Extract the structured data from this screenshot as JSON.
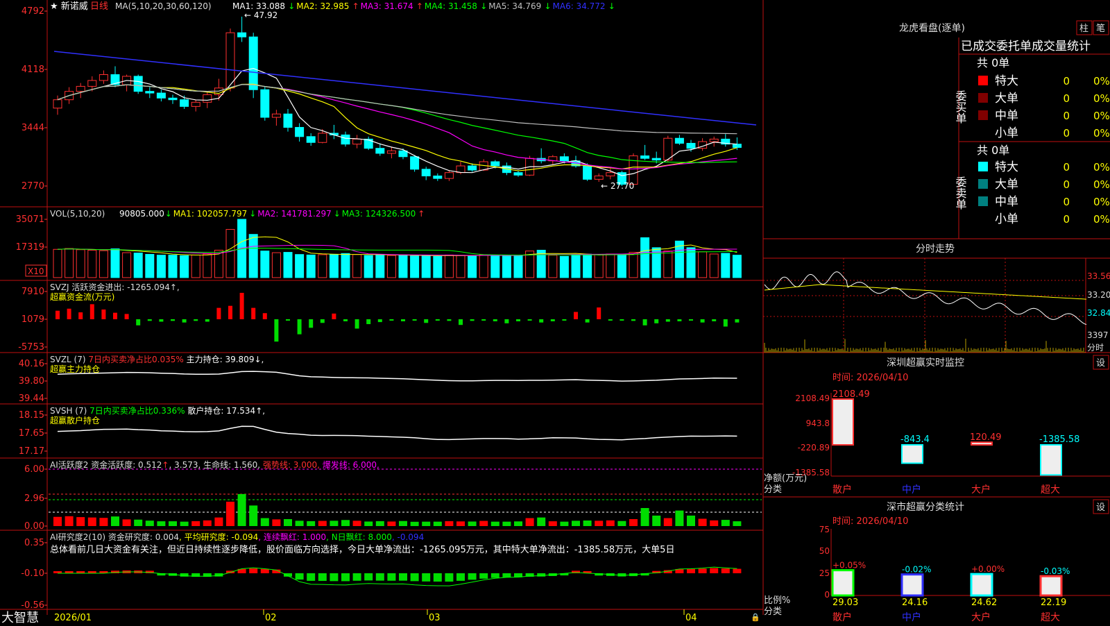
{
  "app": {
    "name": "大智慧"
  },
  "stock": {
    "name": "新诺威",
    "period": "日线"
  },
  "panels": {
    "price": {
      "ma_header": "MA(5,10,20,30,60,120)",
      "ma_items": [
        {
          "text": "MA1: 33.088",
          "arrow": "↓",
          "color": "#ffffff"
        },
        {
          "text": "MA2: 32.985",
          "arrow": "↑",
          "color": "#ffff00"
        },
        {
          "text": "MA3: 31.674",
          "arrow": "↑",
          "color": "#ff00ff"
        },
        {
          "text": "MA4: 31.458",
          "arrow": "↓",
          "color": "#00ff00"
        },
        {
          "text": "MA5: 34.769",
          "arrow": "↓",
          "color": "#c0c0c0"
        },
        {
          "text": "MA6: 34.772",
          "arrow": "↓",
          "color": "#3030ff"
        }
      ],
      "yticks": [
        "4792",
        "4118",
        "3444",
        "2770"
      ],
      "high_label": "47.92",
      "low_label": "27.70"
    },
    "volume": {
      "header": "VOL(5,10,20)",
      "items": [
        {
          "text": "90805.000",
          "arrow": "↓",
          "color": "#ffffff"
        },
        {
          "text": "MA1: 102057.797",
          "arrow": "↓",
          "color": "#ffff00"
        },
        {
          "text": "MA2: 141781.297",
          "arrow": "↓",
          "color": "#ff00ff"
        },
        {
          "text": "MA3: 124326.500",
          "arrow": "↑",
          "color": "#00ff00"
        }
      ],
      "yticks": [
        "35071",
        "17319"
      ],
      "unit": "X10"
    },
    "svzj": {
      "line1": "SVZJ  活跃资金进出: -1265.094↑,",
      "line2": "超赢资金流(万元)",
      "yticks": [
        "7910",
        "1079",
        "-5753"
      ]
    },
    "svzl": {
      "header": "SVZL (7)",
      "item1": "7日内买卖净占比0.035%",
      "item2": "主力持仓: 39.809↓,",
      "line2": "超赢主力持仓",
      "yticks": [
        "40.16",
        "39.80",
        "39.44"
      ]
    },
    "svsh": {
      "header": "SVSH (7)",
      "item1": "7日内买卖净占比0.336%",
      "item2": "散户持仓: 17.534↑,",
      "line2": "超赢散户持仓",
      "yticks": [
        "18.15",
        "17.65",
        "17.17"
      ]
    },
    "ai_active": {
      "part1": "AI活跃度2 资金活跃度: 0.512",
      "part2": ", 3.573, 生命线: 1.560,",
      "part3": "强势线: 3.000,",
      "part4": "爆发线: 6.000,",
      "yticks": [
        "6.00",
        "2.96",
        "0.00"
      ]
    },
    "ai_research": {
      "part1": "AI研究度2(10) 资金研究度: 0.004",
      "part2": ", 平均研究度: -0.094",
      "part3": ", 连续飘红: 1.000",
      "part4": ", N日飘红: 8.000",
      "part5": ", -0.094",
      "summary": "总体看前几日大资金有关注，但近日持续性逐步降低，股价面临方向选择，今日大单净流出：-1265.095万元，其中特大单净流出：-1385.58万元，大单5日",
      "yticks": [
        "0.35",
        "-0.10",
        "-0.56"
      ]
    }
  },
  "xaxis": {
    "labels": [
      "2026/01",
      "02",
      "03",
      "04"
    ]
  },
  "right": {
    "lhb": {
      "title": "龙虎看盘(逐单)",
      "btn1": "柱",
      "btn2": "笔",
      "subtitle": "已成交委托单成交量统计",
      "buy_label": "委买单",
      "sell_label": "委卖单",
      "buy_total": "共 0单",
      "sell_total": "共 0单",
      "buy_rows": [
        {
          "label": "特大",
          "num": "0",
          "pct": "0%",
          "color": "#ff0000"
        },
        {
          "label": "大单",
          "num": "0",
          "pct": "0%",
          "color": "#800000"
        },
        {
          "label": "中单",
          "num": "0",
          "pct": "0%",
          "color": "#800000"
        },
        {
          "label": "小单",
          "num": "0",
          "pct": "0%",
          "color": ""
        }
      ],
      "sell_rows": [
        {
          "label": "特大",
          "num": "0",
          "pct": "0%",
          "color": "#00ffff"
        },
        {
          "label": "大单",
          "num": "0",
          "pct": "0%",
          "color": "#008080"
        },
        {
          "label": "中单",
          "num": "0",
          "pct": "0%",
          "color": "#008080"
        },
        {
          "label": "小单",
          "num": "0",
          "pct": "0%",
          "color": ""
        }
      ]
    },
    "intraday": {
      "title": "分时走势",
      "yticks": [
        "33.56",
        "33.20",
        "32.84"
      ],
      "vol_tick": "3397",
      "vol_label": "分时"
    },
    "monitor": {
      "title": "深圳超赢实时监控",
      "set": "设",
      "time": "时间: 2026/04/10",
      "yticks": [
        "2108.49",
        "943.8",
        "-220.89",
        "-1385.58"
      ],
      "ylabel": "净额(万元)",
      "xlabel": "分类",
      "categories": [
        "散户",
        "中户",
        "大户",
        "超大"
      ],
      "values": [
        2108.49,
        -843.4,
        120.49,
        -1385.58
      ],
      "value_labels": [
        "2108.49",
        "-843.4",
        "120.49",
        "-1385.58"
      ]
    },
    "classify": {
      "title": "深市超赢分类统计",
      "set": "设",
      "time": "时间: 2026/04/10",
      "yticks": [
        "75",
        "50",
        "25",
        "0"
      ],
      "ylabel": "比例%",
      "xlabel": "分类",
      "categories": [
        "散户",
        "中户",
        "大户",
        "超大"
      ],
      "values": [
        29.03,
        24.16,
        24.62,
        22.19
      ],
      "changes": [
        "+0.05%",
        "-0.02%",
        "+0.00%",
        "-0.03%"
      ]
    }
  },
  "chart_data": [
    {
      "type": "candlestick",
      "title": "新诺威 日线",
      "x": [
        "2026/01",
        "02",
        "03",
        "04"
      ],
      "ylim": [
        27.7,
        47.92
      ],
      "high": 47.92,
      "low": 27.7,
      "ohlc": [
        [
          37.0,
          38.5,
          36.2,
          38.0
        ],
        [
          38.0,
          39.5,
          37.5,
          39.0
        ],
        [
          39.0,
          40.0,
          38.2,
          39.6
        ],
        [
          39.6,
          40.8,
          39.0,
          40.3
        ],
        [
          40.3,
          41.5,
          39.9,
          41.0
        ],
        [
          41.0,
          42.0,
          39.5,
          39.8
        ],
        [
          39.8,
          41.0,
          39.0,
          40.8
        ],
        [
          40.8,
          41.0,
          38.7,
          39.0
        ],
        [
          39.0,
          39.5,
          38.2,
          38.8
        ],
        [
          38.8,
          39.2,
          37.8,
          38.2
        ],
        [
          38.2,
          38.6,
          37.5,
          38.0
        ],
        [
          38.0,
          38.5,
          36.9,
          37.2
        ],
        [
          37.2,
          38.0,
          36.6,
          37.7
        ],
        [
          37.7,
          39.0,
          37.0,
          38.6
        ],
        [
          38.6,
          40.5,
          37.9,
          39.4
        ],
        [
          39.4,
          46.5,
          39.0,
          46.0
        ],
        [
          46.0,
          47.92,
          44.9,
          45.5
        ],
        [
          45.5,
          46.0,
          38.2,
          39.2
        ],
        [
          39.2,
          39.6,
          35.5,
          35.9
        ],
        [
          35.9,
          36.8,
          34.9,
          36.3
        ],
        [
          36.3,
          36.9,
          34.2,
          34.7
        ],
        [
          34.7,
          35.2,
          33.0,
          33.6
        ],
        [
          33.6,
          34.0,
          32.5,
          32.9
        ],
        [
          32.9,
          34.5,
          32.8,
          34.0
        ],
        [
          34.0,
          35.0,
          33.3,
          33.8
        ],
        [
          33.8,
          34.2,
          32.4,
          32.7
        ],
        [
          32.7,
          33.8,
          32.2,
          33.3
        ],
        [
          33.3,
          33.6,
          32.0,
          32.2
        ],
        [
          32.2,
          32.8,
          31.3,
          31.6
        ],
        [
          31.6,
          32.4,
          31.0,
          31.9
        ],
        [
          31.9,
          32.2,
          30.9,
          31.2
        ],
        [
          31.2,
          31.4,
          29.4,
          29.7
        ],
        [
          29.7,
          30.0,
          28.4,
          28.9
        ],
        [
          28.9,
          29.2,
          28.3,
          28.6
        ],
        [
          28.6,
          29.6,
          28.3,
          29.3
        ],
        [
          29.3,
          30.6,
          29.1,
          30.1
        ],
        [
          30.1,
          30.4,
          29.4,
          29.6
        ],
        [
          29.6,
          30.9,
          29.5,
          30.6
        ],
        [
          30.6,
          30.8,
          29.8,
          30.1
        ],
        [
          30.1,
          30.5,
          29.0,
          29.3
        ],
        [
          29.3,
          29.5,
          28.8,
          29.0
        ],
        [
          29.0,
          31.3,
          28.9,
          31.0
        ],
        [
          31.0,
          32.2,
          30.4,
          30.7
        ],
        [
          30.7,
          31.4,
          30.3,
          31.2
        ],
        [
          31.2,
          31.6,
          30.4,
          30.7
        ],
        [
          30.7,
          31.3,
          29.9,
          30.1
        ],
        [
          30.1,
          30.4,
          28.3,
          28.5
        ],
        [
          28.5,
          29.2,
          28.2,
          28.9
        ],
        [
          28.9,
          29.8,
          28.5,
          29.3
        ],
        [
          29.3,
          29.5,
          27.7,
          27.9
        ],
        [
          27.9,
          31.6,
          27.8,
          31.3
        ],
        [
          31.3,
          32.6,
          30.8,
          31.0
        ],
        [
          31.0,
          31.8,
          30.4,
          30.8
        ],
        [
          30.8,
          33.7,
          30.6,
          33.4
        ],
        [
          33.4,
          33.8,
          32.6,
          32.8
        ],
        [
          32.8,
          33.2,
          31.8,
          32.2
        ],
        [
          32.2,
          33.4,
          31.9,
          33.0
        ],
        [
          33.0,
          33.6,
          32.4,
          33.3
        ],
        [
          33.3,
          33.9,
          32.4,
          32.7
        ],
        [
          32.7,
          33.5,
          32.0,
          32.3
        ]
      ]
    },
    {
      "type": "bar",
      "title": "VOL(5,10,20)",
      "ylim": [
        0,
        35071
      ],
      "values": [
        17000,
        17500,
        16800,
        16500,
        16200,
        17300,
        15000,
        14800,
        14000,
        13500,
        13500,
        13200,
        13600,
        14200,
        16500,
        29000,
        35071,
        26000,
        16000,
        15000,
        15200,
        13900,
        13600,
        13800,
        13900,
        14500,
        13900,
        13300,
        13600,
        13300,
        13700,
        13100,
        13200,
        12800,
        13600,
        13400,
        13300,
        13800,
        13200,
        13200,
        13400,
        16000,
        16500,
        13500,
        12800,
        13900,
        14100,
        13900,
        14200,
        13700,
        15200,
        24000,
        18000,
        16000,
        22000,
        18000,
        15500,
        14200,
        14600,
        13500
      ]
    },
    {
      "type": "bar",
      "title": "SVZJ",
      "ylim": [
        -5753,
        7910
      ],
      "values": [
        2100,
        2600,
        1700,
        3700,
        2400,
        1600,
        1300,
        -1500,
        -400,
        -600,
        -400,
        -800,
        -400,
        -600,
        2800,
        3300,
        6500,
        2800,
        1500,
        -5500,
        -300,
        -3700,
        -2100,
        -900,
        1400,
        -500,
        -2300,
        -1200,
        -700,
        -300,
        -500,
        -300,
        -900,
        -300,
        -400,
        -1400,
        -400,
        -300,
        -500,
        -1000,
        -500,
        -300,
        -800,
        -500,
        -300,
        1800,
        -800,
        2900,
        -200,
        -200,
        -400,
        -1500,
        -1000,
        -600,
        -500,
        -200,
        -800,
        -500,
        -1800,
        -800
      ]
    },
    {
      "type": "bar",
      "title": "深圳超赢实时监控",
      "categories": [
        "散户",
        "中户",
        "大户",
        "超大"
      ],
      "values": [
        2108.49,
        -843.4,
        120.49,
        -1385.58
      ],
      "ylim": [
        -1385.58,
        2108.49
      ],
      "ylabel": "净额(万元)"
    },
    {
      "type": "bar",
      "title": "深市超赢分类统计",
      "categories": [
        "散户",
        "中户",
        "大户",
        "超大"
      ],
      "values": [
        29.03,
        24.16,
        24.62,
        22.19
      ],
      "ylim": [
        0,
        75
      ],
      "ylabel": "比例%"
    }
  ]
}
